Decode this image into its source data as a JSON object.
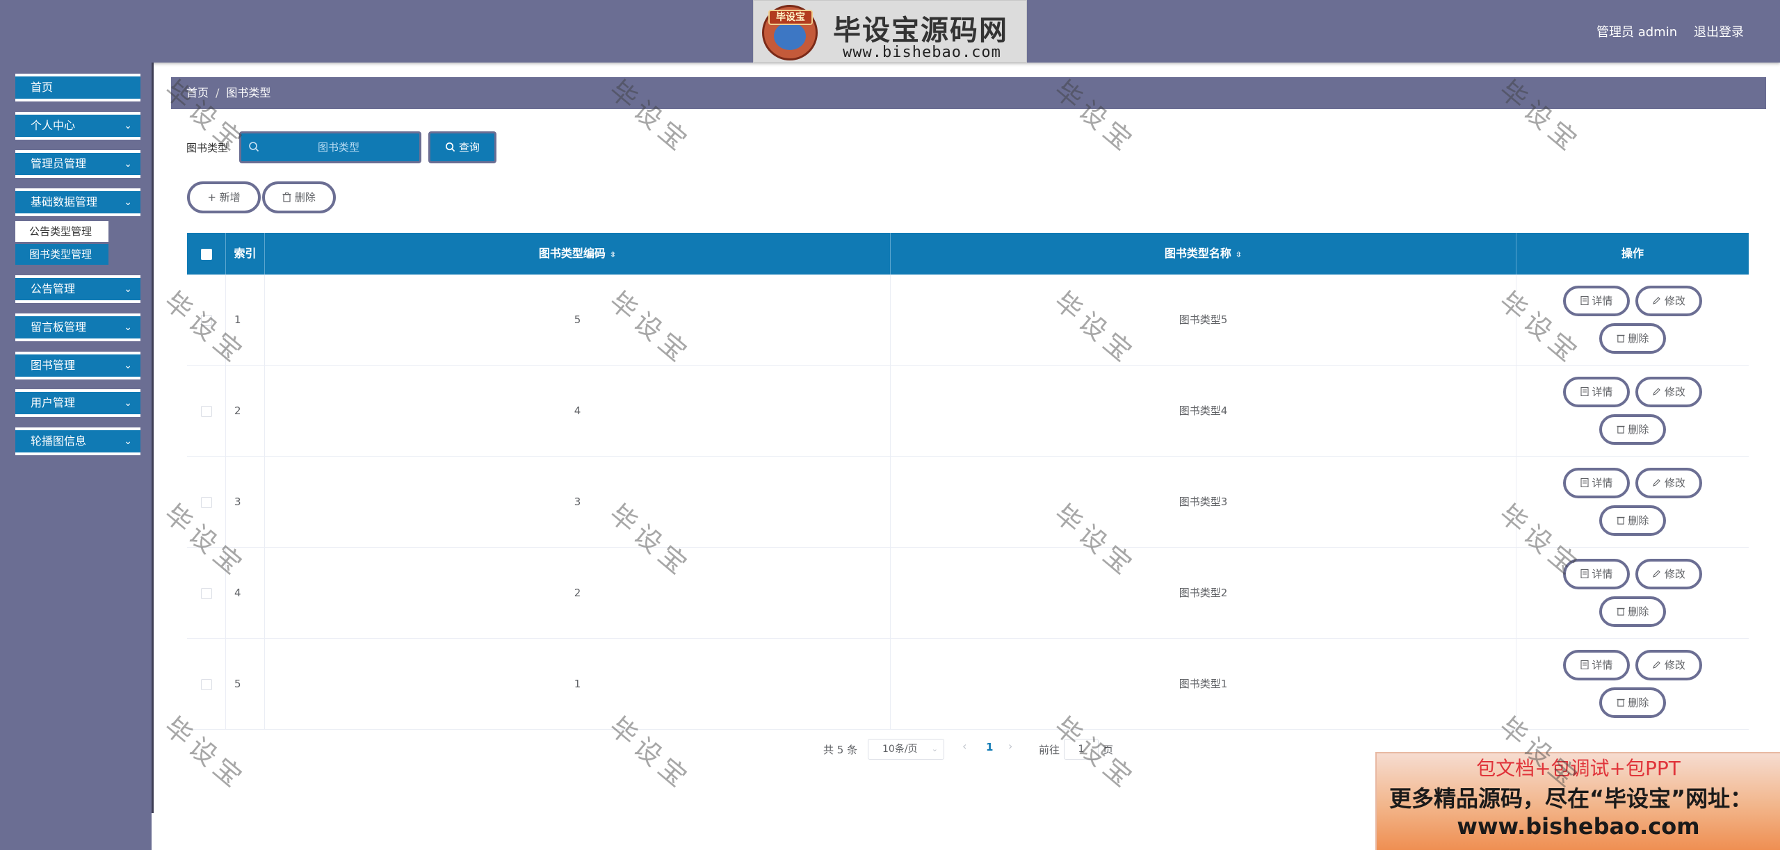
{
  "header": {
    "logo_badge": "毕设宝",
    "logo_title": "毕设宝源码网",
    "logo_url": "www.bishebao.com",
    "user": "管理员 admin",
    "logout": "退出登录"
  },
  "sidebar": {
    "items": [
      {
        "label": "首页",
        "chevron": ""
      },
      {
        "label": "个人中心",
        "chevron": "⌄"
      },
      {
        "label": "管理员管理",
        "chevron": "⌄"
      },
      {
        "label": "基础数据管理",
        "chevron": "⌄"
      },
      {
        "label": "公告管理",
        "chevron": "⌄"
      },
      {
        "label": "留言板管理",
        "chevron": "⌄"
      },
      {
        "label": "图书管理",
        "chevron": "⌄"
      },
      {
        "label": "用户管理",
        "chevron": "⌄"
      },
      {
        "label": "轮播图信息",
        "chevron": "⌄"
      }
    ],
    "submenu": [
      "公告类型管理",
      "图书类型管理"
    ]
  },
  "breadcrumb": {
    "home": "首页",
    "sep": "/",
    "current": "图书类型"
  },
  "search": {
    "label": "图书类型",
    "placeholder": "图书类型",
    "button": "查询"
  },
  "actions": {
    "add": "+ 新增",
    "delete": "删除"
  },
  "table": {
    "columns": [
      "索引",
      "图书类型编码",
      "图书类型名称",
      "操作"
    ],
    "sort_glyph": "⇳",
    "rows": [
      {
        "index": "1",
        "code": "5",
        "name": "图书类型5"
      },
      {
        "index": "2",
        "code": "4",
        "name": "图书类型4"
      },
      {
        "index": "3",
        "code": "3",
        "name": "图书类型3"
      },
      {
        "index": "4",
        "code": "2",
        "name": "图书类型2"
      },
      {
        "index": "5",
        "code": "1",
        "name": "图书类型1"
      }
    ],
    "row_actions": {
      "detail": "详情",
      "edit": "修改",
      "delete": "删除"
    }
  },
  "pagination": {
    "total": "共 5 条",
    "page_size": "10条/页",
    "current_page": "1",
    "goto": "前往",
    "goto_value": "1",
    "unit": "页"
  },
  "ad": {
    "line1": "包文档+包调试+包PPT",
    "line2": "更多精品源码，尽在“毕设宝”网址：",
    "line3": "www.bishebao.com"
  },
  "watermark": "毕设宝",
  "colors": {
    "theme": "#6b6e93",
    "primary": "#107ab4"
  }
}
